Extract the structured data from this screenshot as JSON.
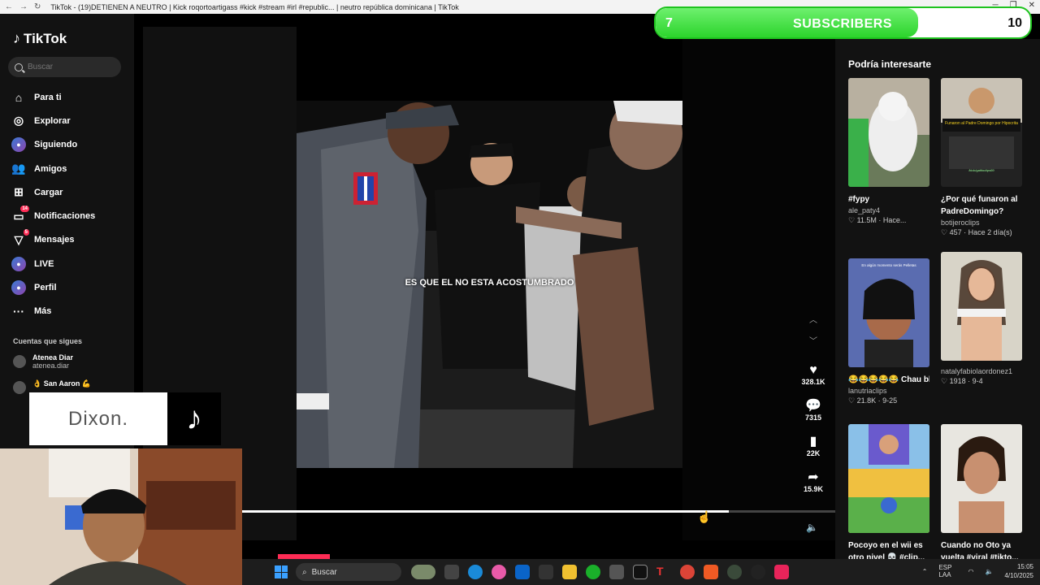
{
  "browser": {
    "title": "TikTok - (19)DETIENEN A NEUTRO | Kick roqortoartigass #kick #stream #irl #republic... | neutro república dominicana | TikTok"
  },
  "sidebar": {
    "logo": "TikTok",
    "search_placeholder": "Buscar",
    "items": [
      {
        "label": "Para ti",
        "icon": "home-icon",
        "glyph": "⌂"
      },
      {
        "label": "Explorar",
        "icon": "compass-icon",
        "glyph": "◎"
      },
      {
        "label": "Siguiendo",
        "icon": "following-icon",
        "glyph": "●"
      },
      {
        "label": "Amigos",
        "icon": "friends-icon",
        "glyph": "👥"
      },
      {
        "label": "Cargar",
        "icon": "upload-icon",
        "glyph": "⊞"
      },
      {
        "label": "Notificaciones",
        "icon": "inbox-icon",
        "glyph": "▭",
        "badge": "14"
      },
      {
        "label": "Mensajes",
        "icon": "send-icon",
        "glyph": "▽",
        "badge": "5"
      },
      {
        "label": "LIVE",
        "icon": "live-icon",
        "glyph": "●"
      },
      {
        "label": "Perfil",
        "icon": "profile-icon",
        "glyph": "●"
      },
      {
        "label": "Más",
        "icon": "more-icon",
        "glyph": "···"
      }
    ],
    "following_heading": "Cuentas que sigues",
    "following": [
      {
        "name": "Atenea Diar",
        "handle": "atenea.diar"
      },
      {
        "name": "👌 San Aaron 💪",
        "handle": ""
      }
    ]
  },
  "video": {
    "caption": "ES QUE EL NO ESTA ACOSTUMBRADO",
    "progress": 0.82,
    "likes": "328.1K",
    "comments": "7315",
    "saves": "22K",
    "shares": "15.9K"
  },
  "subscribers": {
    "current": "7",
    "label": "SUBSCRIBERS",
    "goal": "10",
    "fraction": 0.7,
    "color": "#2cd42c"
  },
  "recommend": {
    "heading": "Podría interesarte",
    "cards": [
      {
        "title": "#fypy",
        "author": "ale_paty4",
        "meta": "♡ 11.5M · Hace..."
      },
      {
        "title": "¿Por qué funaron al PadreDomingo?",
        "author": "botijeroclips",
        "meta": "♡ 457 · Hace 2 día(s)"
      },
      {
        "title": "😂😂😂😂😂 Chau bb #kingleon...",
        "author": "lanutriaclips",
        "meta": "♡ 21.8K · 9-25"
      },
      {
        "title": "",
        "author": "natalyfabiolaordonez1",
        "meta": "♡ 1918 · 9-4"
      },
      {
        "title": "Pocoyo en el wii es otro nivel 💀 #clip...",
        "author": "",
        "meta": ""
      },
      {
        "title": "Cuando no Oto ya vuelta #viral #tikto...",
        "author": "",
        "meta": ""
      }
    ],
    "thumb_texts": {
      "padre": "Funaron al Padre Domingo por Hipocrita",
      "kick": "/kick/gatitoclips69",
      "wii_sign": "En algún momento serás Pelletas"
    }
  },
  "overlay": {
    "brand": "Dixon."
  },
  "taskbar": {
    "search": "Buscar",
    "lang": "ESP LAA",
    "time": "15:05",
    "date": "4/10/2025"
  }
}
